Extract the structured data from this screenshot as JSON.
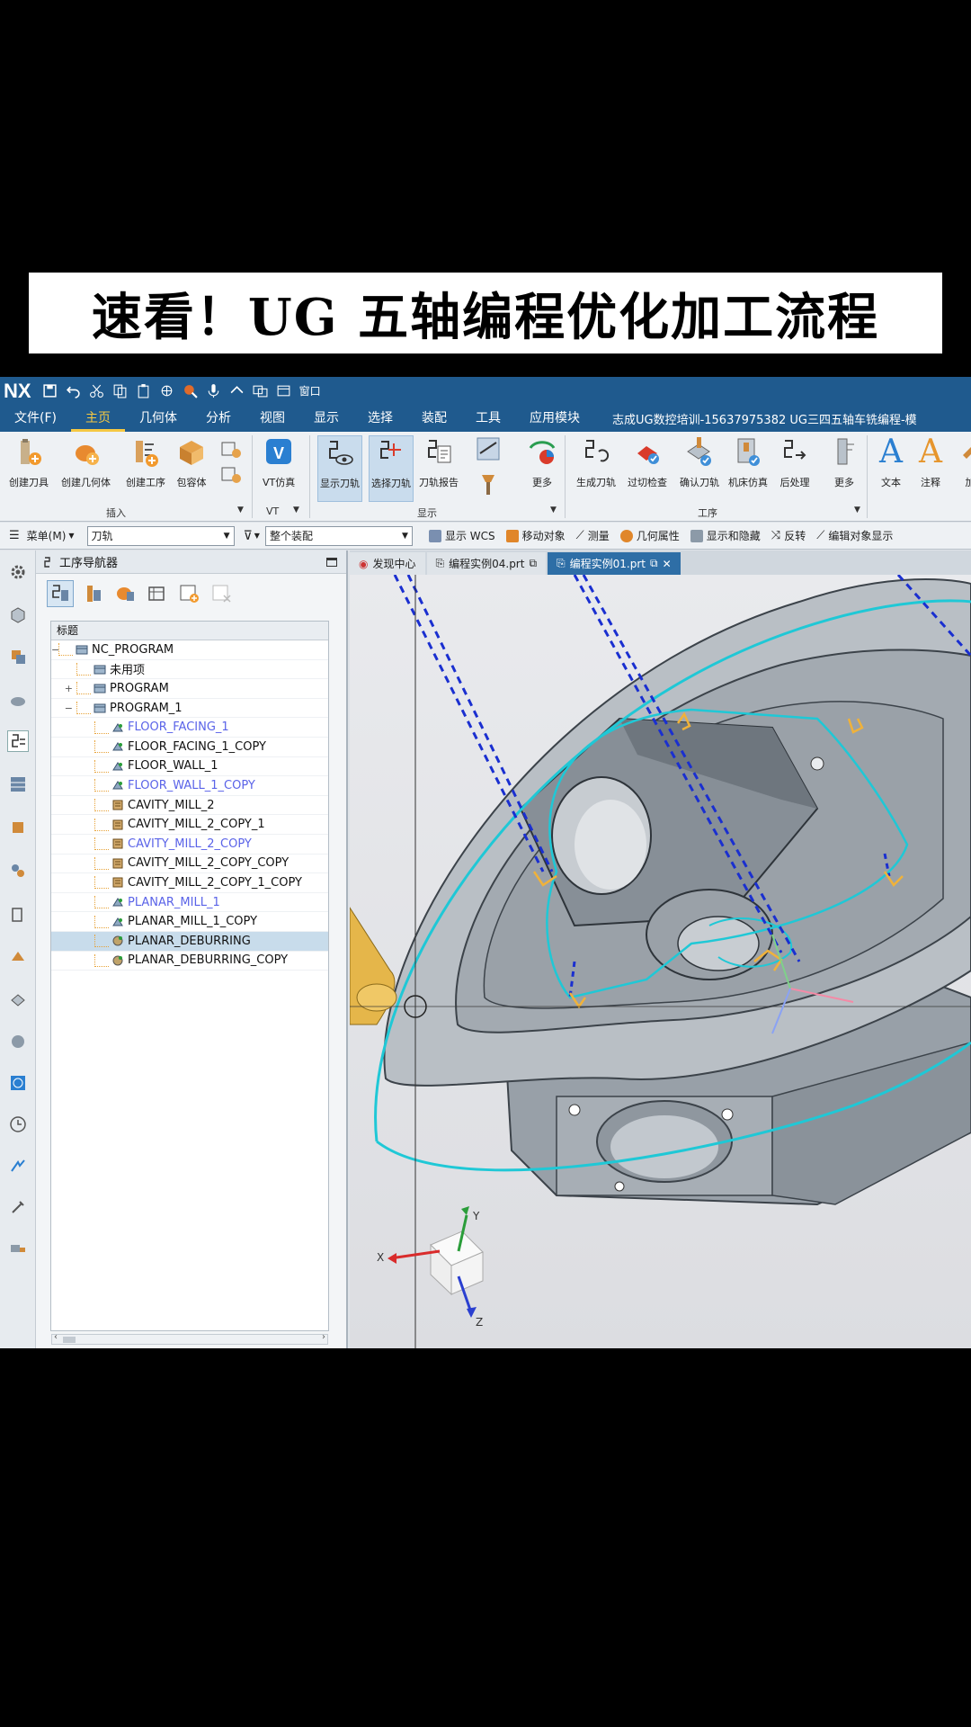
{
  "banner": {
    "title": "速看！UG 五轴编程优化加工流程"
  },
  "titlebar": {
    "logo": "NX",
    "window_menu": "窗口"
  },
  "menubar": {
    "items": [
      "文件(F)",
      "主页",
      "几何体",
      "分析",
      "视图",
      "显示",
      "选择",
      "装配",
      "工具",
      "应用模块"
    ],
    "active": "主页",
    "info": "志成UG数控培训-15637975382  UG三四五轴车铣编程-模"
  },
  "ribbon": {
    "insert_buttons": [
      "创建刀具",
      "创建几何体",
      "创建工序",
      "包容体"
    ],
    "vt_button": "VT仿真",
    "display_buttons": [
      "显示刀轨",
      "选择刀轨",
      "刀轨报告",
      "更多"
    ],
    "operation_buttons": [
      "生成刀轨",
      "过切检查",
      "确认刀轨",
      "机床仿真",
      "后处理",
      "更多"
    ],
    "annotation_buttons": [
      "文本",
      "注释",
      "加"
    ],
    "groups": {
      "insert": "插入",
      "vt": "VT",
      "display": "显示",
      "operation": "工序"
    }
  },
  "toolbar2": {
    "menu": "菜单(M)",
    "filter_value": "刀轨",
    "scope_value": "整个装配",
    "items": [
      "显示 WCS",
      "移动对象",
      "测量",
      "几何属性",
      "显示和隐藏",
      "反转",
      "编辑对象显示"
    ]
  },
  "navigator": {
    "title": "工序导航器",
    "column_header": "标题",
    "rows": [
      {
        "label": "NC_PROGRAM",
        "indent": 0,
        "kind": "program",
        "blue": false,
        "selected": false,
        "expander": "−"
      },
      {
        "label": "未用项",
        "indent": 1,
        "kind": "program",
        "blue": false,
        "selected": false,
        "expander": ""
      },
      {
        "label": "PROGRAM",
        "indent": 1,
        "kind": "program",
        "blue": false,
        "selected": false,
        "expander": "+"
      },
      {
        "label": "PROGRAM_1",
        "indent": 1,
        "kind": "program",
        "blue": false,
        "selected": false,
        "expander": "−"
      },
      {
        "label": "FLOOR_FACING_1",
        "indent": 2,
        "kind": "op",
        "blue": true,
        "selected": false,
        "expander": ""
      },
      {
        "label": "FLOOR_FACING_1_COPY",
        "indent": 2,
        "kind": "op",
        "blue": false,
        "selected": false,
        "expander": ""
      },
      {
        "label": "FLOOR_WALL_1",
        "indent": 2,
        "kind": "op",
        "blue": false,
        "selected": false,
        "expander": ""
      },
      {
        "label": "FLOOR_WALL_1_COPY",
        "indent": 2,
        "kind": "op",
        "blue": true,
        "selected": false,
        "expander": ""
      },
      {
        "label": "CAVITY_MILL_2",
        "indent": 2,
        "kind": "cav",
        "blue": false,
        "selected": false,
        "expander": ""
      },
      {
        "label": "CAVITY_MILL_2_COPY_1",
        "indent": 2,
        "kind": "cav",
        "blue": false,
        "selected": false,
        "expander": ""
      },
      {
        "label": "CAVITY_MILL_2_COPY",
        "indent": 2,
        "kind": "cav",
        "blue": true,
        "selected": false,
        "expander": ""
      },
      {
        "label": "CAVITY_MILL_2_COPY_COPY",
        "indent": 2,
        "kind": "cav",
        "blue": false,
        "selected": false,
        "expander": ""
      },
      {
        "label": "CAVITY_MILL_2_COPY_1_COPY",
        "indent": 2,
        "kind": "cav",
        "blue": false,
        "selected": false,
        "expander": ""
      },
      {
        "label": "PLANAR_MILL_1",
        "indent": 2,
        "kind": "op",
        "blue": true,
        "selected": false,
        "expander": ""
      },
      {
        "label": "PLANAR_MILL_1_COPY",
        "indent": 2,
        "kind": "op",
        "blue": false,
        "selected": false,
        "expander": ""
      },
      {
        "label": "PLANAR_DEBURRING",
        "indent": 2,
        "kind": "deb",
        "blue": false,
        "selected": true,
        "expander": ""
      },
      {
        "label": "PLANAR_DEBURRING_COPY",
        "indent": 2,
        "kind": "deb",
        "blue": false,
        "selected": false,
        "expander": ""
      }
    ]
  },
  "tabs": [
    {
      "label": "发现中心",
      "active": false
    },
    {
      "label": "编程实例04.prt",
      "active": false
    },
    {
      "label": "编程实例01.prt",
      "active": true
    }
  ],
  "triad": {
    "x": "X",
    "y": "Y",
    "z": "Z"
  },
  "colors": {
    "title_bg": "#1f5a8e",
    "accent": "#f5c842",
    "toolpath": "#1fc8d6",
    "rapid": "#1a2fd0",
    "part": "#a7adb3"
  }
}
